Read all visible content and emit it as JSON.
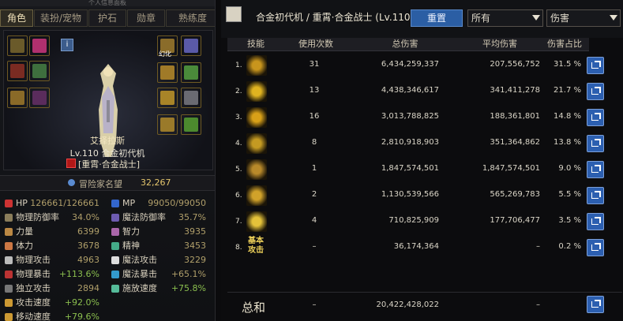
{
  "character": {
    "window_title": "个人信息面板",
    "tabs": [
      "角色",
      "装扮/宠物",
      "护石",
      "勋章",
      "熟练度"
    ],
    "active_tab": 0,
    "name": "艾择拉斯",
    "level": "Lv.110 合金初代机",
    "class_tag": "[重霄·合金战士]",
    "equip_badge": "幻化",
    "fame_label": "冒险家名望",
    "fame_value": "32,267",
    "stats": [
      {
        "label": "HP",
        "value": "126661/126661",
        "side": "left",
        "icon": "heart-icon",
        "color": "#c33",
        "green": false
      },
      {
        "label": "MP",
        "value": "99050/99050",
        "side": "right",
        "icon": "mana-icon",
        "color": "#36c",
        "green": false
      },
      {
        "label": "物理防御率",
        "value": "34.0%",
        "side": "left",
        "icon": "shield-icon",
        "color": "#8a7d5b",
        "green": false
      },
      {
        "label": "魔法防御率",
        "value": "35.7%",
        "side": "right",
        "icon": "magic-shield-icon",
        "color": "#6d5bb0",
        "green": false
      },
      {
        "label": "力量",
        "value": "6399",
        "side": "left",
        "icon": "strength-icon",
        "color": "#b84",
        "green": false
      },
      {
        "label": "智力",
        "value": "3935",
        "side": "right",
        "icon": "intellect-icon",
        "color": "#a6a",
        "green": false
      },
      {
        "label": "体力",
        "value": "3678",
        "side": "left",
        "icon": "vitality-icon",
        "color": "#c74",
        "green": false
      },
      {
        "label": "精神",
        "value": "3453",
        "side": "right",
        "icon": "spirit-icon",
        "color": "#4a8",
        "green": false
      },
      {
        "label": "物理攻击",
        "value": "4963",
        "side": "left",
        "icon": "sword-icon",
        "color": "#bbb",
        "green": false
      },
      {
        "label": "魔法攻击",
        "value": "3229",
        "side": "right",
        "icon": "magic-star-icon",
        "color": "#ddd",
        "green": false
      },
      {
        "label": "物理暴击",
        "value": "+113.6%",
        "side": "left",
        "icon": "phys-crit-icon",
        "color": "#b33",
        "green": true
      },
      {
        "label": "魔法暴击",
        "value": "+65.1%",
        "side": "right",
        "icon": "magic-crit-icon",
        "color": "#39c",
        "green": false
      },
      {
        "label": "独立攻击",
        "value": "2894",
        "side": "left",
        "icon": "independent-atk-icon",
        "color": "#777",
        "green": false
      },
      {
        "label": "攻击速度",
        "value": "+92.0%",
        "side": "left",
        "icon": "attack-speed-icon",
        "color": "#c93",
        "green": true
      },
      {
        "label": "施放速度",
        "value": "+75.8%",
        "side": "right",
        "icon": "cast-speed-icon",
        "color": "#5b9",
        "green": true
      },
      {
        "label": "移动速度",
        "value": "+79.6%",
        "side": "left",
        "icon": "move-speed-icon",
        "color": "#c93",
        "green": true
      }
    ]
  },
  "damage": {
    "title": "合金初代机 / 重霄·合金战士 (Lv.110)",
    "reset_label": "重置",
    "filter_value": "所有",
    "metric_value": "伤害",
    "columns": [
      "技能",
      "使用次数",
      "总伤害",
      "平均伤害",
      "伤害占比"
    ],
    "rows": [
      {
        "rank": "1.",
        "uses": "31",
        "total": "6,434,259,337",
        "avg": "207,556,752",
        "pct": "31.5 %",
        "icon_color": "#c8951d"
      },
      {
        "rank": "2.",
        "uses": "13",
        "total": "4,438,346,617",
        "avg": "341,411,278",
        "pct": "21.7 %",
        "icon_color": "#e0b320"
      },
      {
        "rank": "3.",
        "uses": "16",
        "total": "3,013,788,825",
        "avg": "188,361,801",
        "pct": "14.8 %",
        "icon_color": "#d8a018"
      },
      {
        "rank": "4.",
        "uses": "8",
        "total": "2,810,918,903",
        "avg": "351,364,862",
        "pct": "13.8 %",
        "icon_color": "#c49a22"
      },
      {
        "rank": "5.",
        "uses": "1",
        "total": "1,847,574,501",
        "avg": "1,847,574,501",
        "pct": "9.0 %",
        "icon_color": "#b8892a"
      },
      {
        "rank": "6.",
        "uses": "2",
        "total": "1,130,539,566",
        "avg": "565,269,783",
        "pct": "5.5 %",
        "icon_color": "#d1a22a"
      },
      {
        "rank": "7.",
        "uses": "4",
        "total": "710,825,909",
        "avg": "177,706,477",
        "pct": "3.5 %",
        "icon_color": "#e4c23a"
      },
      {
        "rank": "8.",
        "uses": "–",
        "total": "36,174,364",
        "avg": "–",
        "pct": "0.2 %",
        "icon_color": "#000000",
        "icon_text": "基本攻击"
      }
    ],
    "total_label": "总和",
    "total_uses": "–",
    "total_damage": "20,422,428,022",
    "total_avg": "–"
  }
}
